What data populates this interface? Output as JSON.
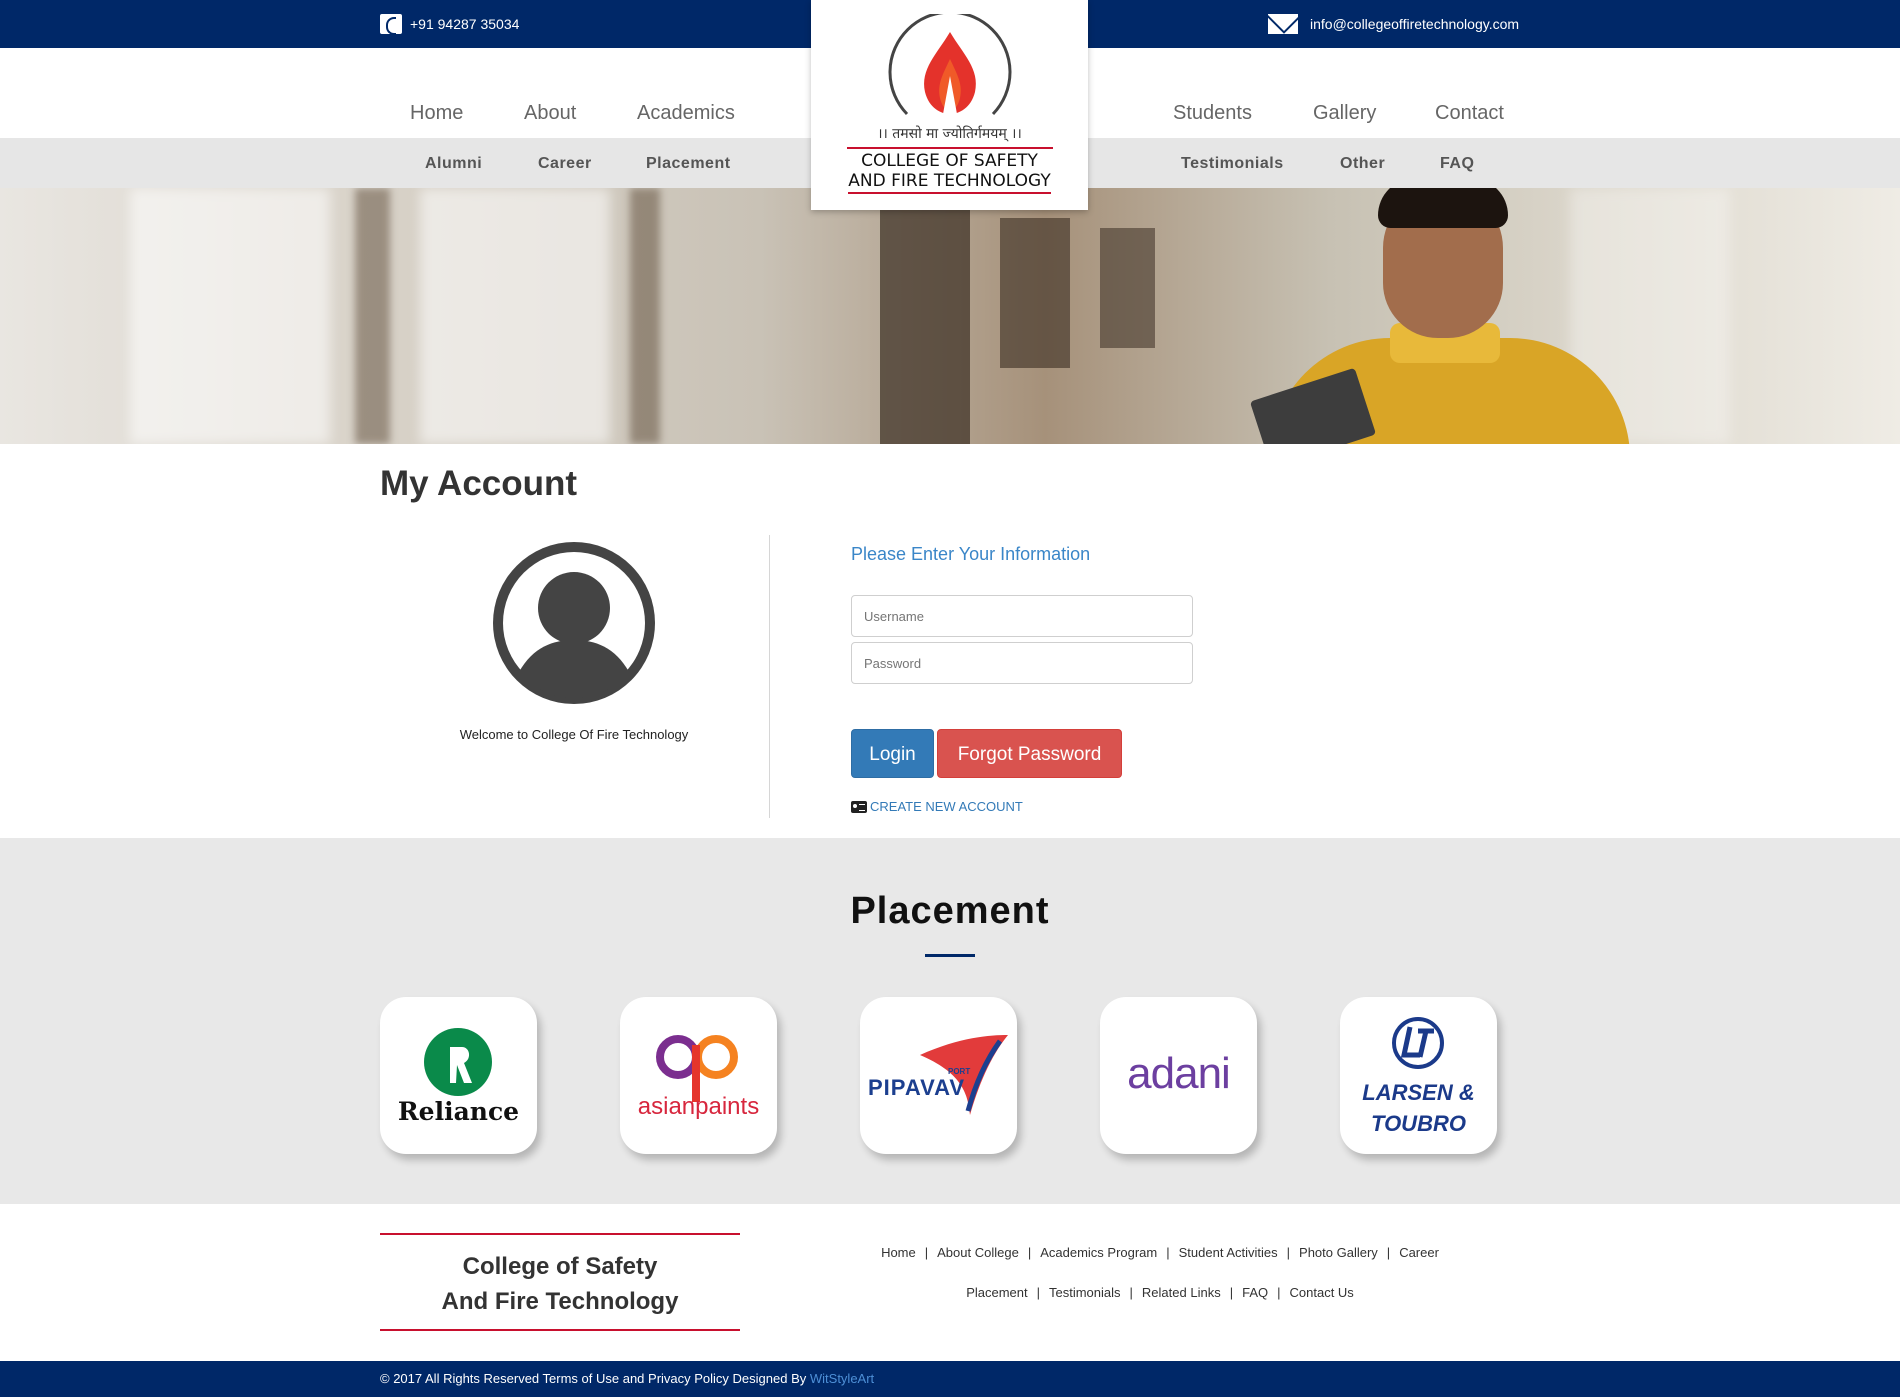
{
  "topbar": {
    "phone": "+91 94287 35034",
    "email": "info@collegeoffiretechnology.com"
  },
  "nav": {
    "main": [
      "Home",
      "About",
      "Academics",
      "Students",
      "Gallery",
      "Contact"
    ],
    "sub": [
      "Alumni",
      "Career",
      "Placement",
      "Testimonials",
      "Other",
      "FAQ"
    ]
  },
  "logo": {
    "motto": "।। तमसो मा ज्योतिर्गमयम् ।।",
    "name_line1": "COLLEGE OF SAFETY",
    "name_line2": "AND FIRE TECHNOLOGY"
  },
  "account": {
    "title": "My Account",
    "welcome": "Welcome to College Of Fire Technology",
    "form_title": "Please Enter Your Information",
    "username_placeholder": "Username",
    "password_placeholder": "Password",
    "login_label": "Login",
    "forgot_label": "Forgot Password",
    "create_label": "CREATE NEW ACCOUNT"
  },
  "placement": {
    "title": "Placement",
    "companies": [
      "Reliance",
      "asianpaints",
      "PIPAVAV",
      "adani",
      "LARSEN & TOUBRO"
    ],
    "pipavav_small": "PORT",
    "lt_line1": "LARSEN &",
    "lt_line2": "TOUBRO"
  },
  "footer": {
    "brand_line1": "College of Safety",
    "brand_line2": "And Fire Technology",
    "links_row1": [
      "Home",
      "About College",
      "Academics Program",
      "Student Activities",
      "Photo Gallery",
      "Career"
    ],
    "links_row2": [
      "Placement",
      "Testimonials",
      "Related Links",
      "FAQ",
      "Contact Us"
    ],
    "separator": "|",
    "copyright": "© 2017 All Rights Reserved Terms of Use and Privacy Policy Designed By ",
    "designer": "WitStyleArt"
  },
  "colors": {
    "navy": "#002868",
    "accent_red": "#c8102e",
    "link_blue": "#337ab7",
    "danger": "#d9534f"
  }
}
